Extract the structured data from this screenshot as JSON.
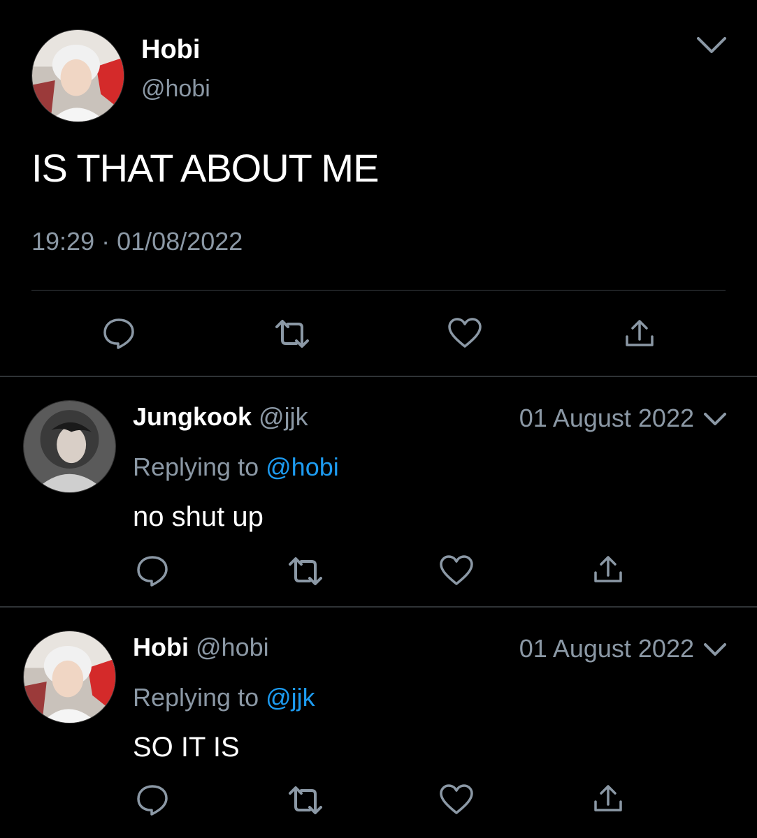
{
  "main_tweet": {
    "author_name": "Hobi",
    "author_handle": "@hobi",
    "text": "IS THAT ABOUT ME",
    "time": "19:29",
    "separator": "·",
    "date": "01/08/2022"
  },
  "replies": [
    {
      "author_name": "Jungkook",
      "author_handle": "@jjk",
      "date": "01 August 2022",
      "replying_prefix": "Replying to",
      "replying_to": "@hobi",
      "text": "no shut up"
    },
    {
      "author_name": "Hobi",
      "author_handle": "@hobi",
      "date": "01 August 2022",
      "replying_prefix": "Replying to",
      "replying_to": "@jjk",
      "text": "SO IT IS"
    }
  ],
  "icons": [
    "reply-icon",
    "retweet-icon",
    "like-icon",
    "share-icon",
    "chevron-down-icon"
  ],
  "colors": {
    "background": "#000000",
    "text": "#ffffff",
    "secondary": "#8b98a5",
    "link": "#1d9bf0"
  }
}
